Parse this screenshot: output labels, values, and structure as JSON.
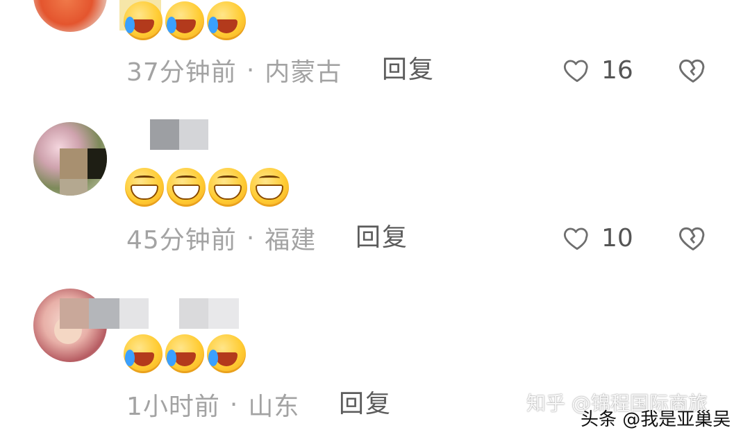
{
  "comments": [
    {
      "time": "37分钟前",
      "separator": "·",
      "location": "内蒙古",
      "reply_label": "回复",
      "like_count": "16",
      "emojis": [
        "cry-laugh",
        "cry-laugh",
        "cry-laugh"
      ]
    },
    {
      "time": "45分钟前",
      "separator": "·",
      "location": "福建",
      "reply_label": "回复",
      "like_count": "10",
      "emojis": [
        "grin",
        "grin",
        "grin",
        "grin"
      ]
    },
    {
      "time": "1小时前",
      "separator": "·",
      "location": "山东",
      "reply_label": "回复",
      "emojis": [
        "cry-laugh",
        "cry-laugh",
        "cry-laugh"
      ]
    }
  ],
  "watermarks": {
    "zhihu": "知乎 @锦程国际商旅",
    "toutiao": "头条 @我是亚巢吴"
  },
  "icons": {
    "like": "heart-outline-icon",
    "dislike": "broken-heart-icon"
  },
  "colors": {
    "meta_text": "#a3a3a3",
    "reply_text": "#5c5c5c",
    "icon_stroke": "#6e6e6e"
  }
}
